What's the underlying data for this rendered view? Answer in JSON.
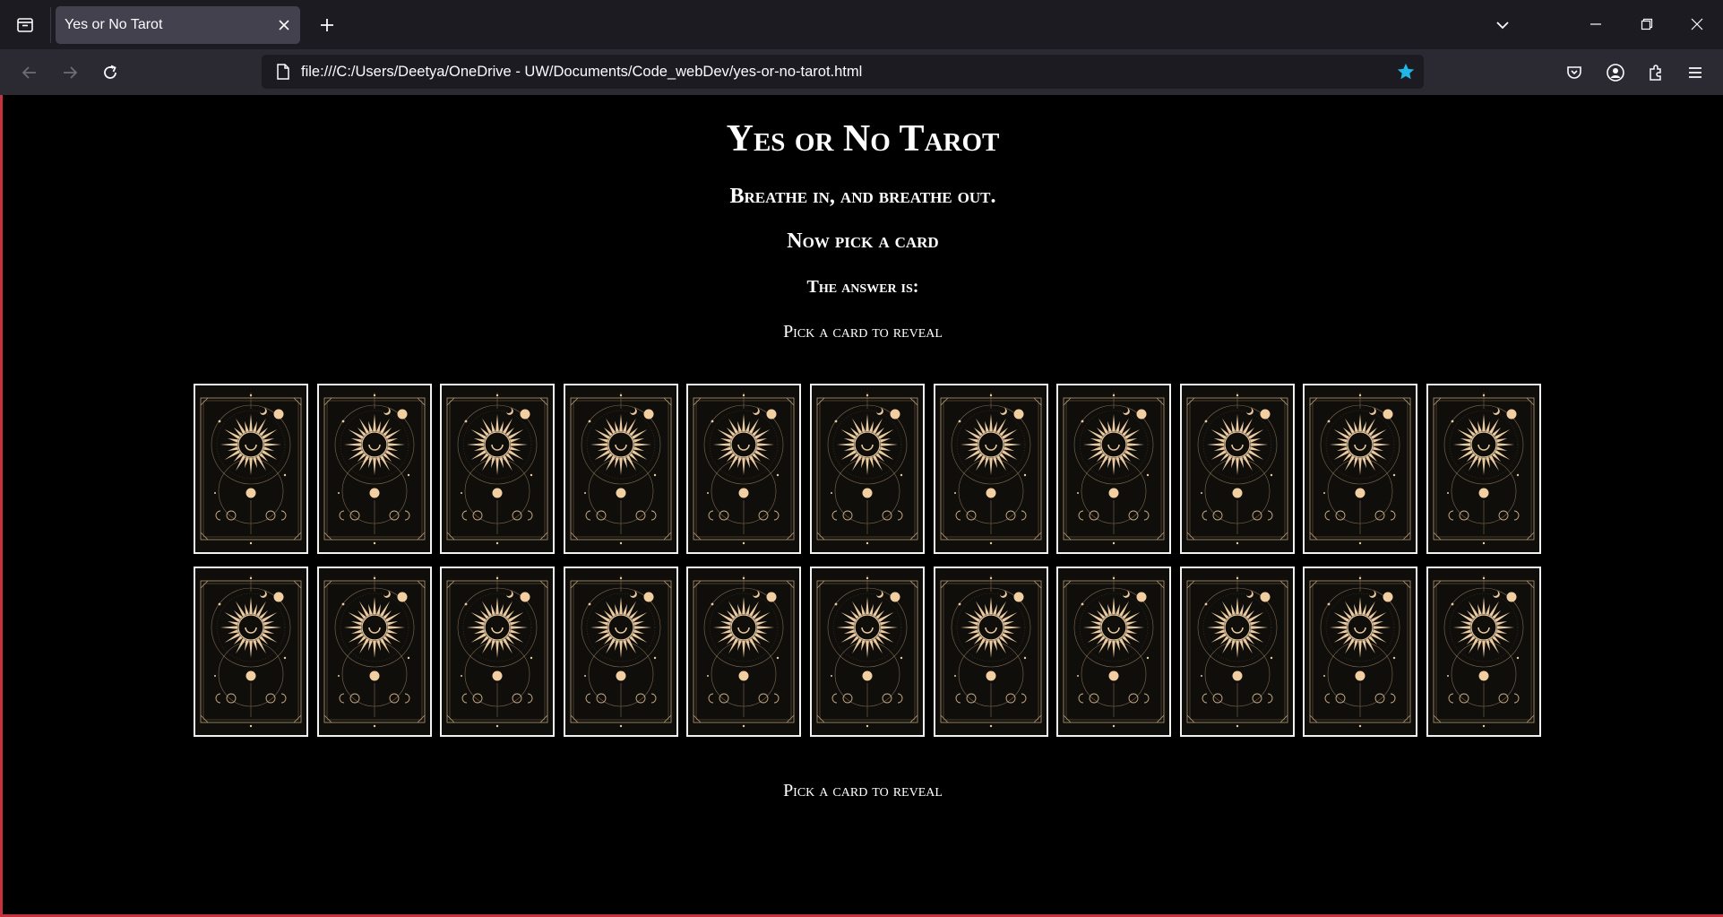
{
  "browser": {
    "tab_title": "Yes or No Tarot",
    "url": "file:///C:/Users/Deetya/OneDrive - UW/Documents/Code_webDev/yes-or-no-tarot.html",
    "accent_color": "#1fb7e6"
  },
  "page": {
    "title": "Yes or No Tarot",
    "line1": "Breathe in, and breathe out.",
    "line2": "Now pick a card",
    "answer_label": "The answer is:",
    "answer_text": "Pick a card to reveal",
    "footer_text": "Pick a card to reveal"
  },
  "cards": {
    "rows": 2,
    "per_row": 11,
    "card_back": "sun-and-moon-tarot-back"
  }
}
